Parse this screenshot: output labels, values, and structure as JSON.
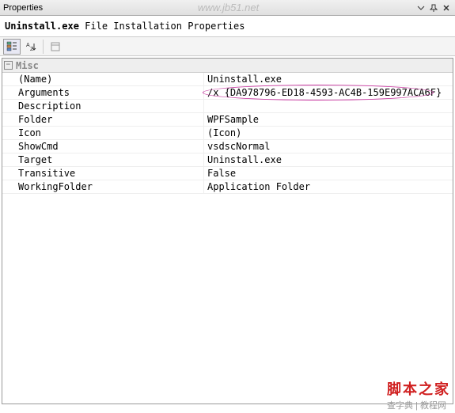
{
  "titlebar": {
    "title": "Properties",
    "watermark": "www.jb51.net"
  },
  "header": {
    "filename": "Uninstall.exe",
    "suffix": " File Installation Properties"
  },
  "group": {
    "label": "Misc"
  },
  "rows": [
    {
      "label": "(Name)",
      "value": "Uninstall.exe",
      "highlight": false
    },
    {
      "label": "Arguments",
      "value": "/x {DA978796-ED18-4593-AC4B-159E997ACA6F}",
      "highlight": true
    },
    {
      "label": "Description",
      "value": "",
      "highlight": false
    },
    {
      "label": "Folder",
      "value": "WPFSample",
      "highlight": false
    },
    {
      "label": "Icon",
      "value": "(Icon)",
      "highlight": false
    },
    {
      "label": "ShowCmd",
      "value": "vsdscNormal",
      "highlight": false
    },
    {
      "label": "Target",
      "value": "Uninstall.exe",
      "highlight": false
    },
    {
      "label": "Transitive",
      "value": "False",
      "highlight": false
    },
    {
      "label": "WorkingFolder",
      "value": "Application Folder",
      "highlight": false
    }
  ],
  "footer": {
    "brand": "脚本之家",
    "credit": "查字典 | 教程网"
  }
}
